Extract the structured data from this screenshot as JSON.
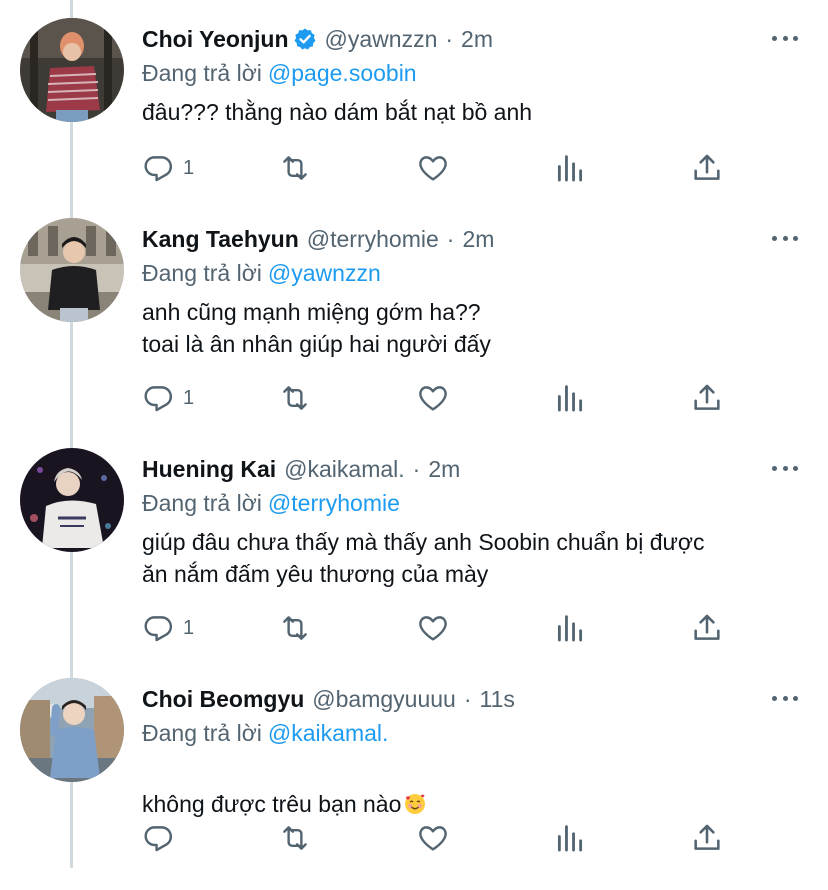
{
  "tweets": [
    {
      "name": "Choi Yeonjun",
      "verified": true,
      "handle": "@yawnzzn",
      "time": "2m",
      "reply_prefix": "Đang trả lời",
      "reply_to": "@page.soobin",
      "text": "đâu??? thằng nào dám bắt nạt bồ anh",
      "reply_count": "1"
    },
    {
      "name": "Kang Taehyun",
      "verified": false,
      "handle": "@terryhomie",
      "time": "2m",
      "reply_prefix": "Đang trả lời",
      "reply_to": "@yawnzzn",
      "text": "anh cũng mạnh miệng gớm ha??\n toai là ân nhân giúp hai người đấy",
      "reply_count": "1"
    },
    {
      "name": "Huening Kai",
      "verified": false,
      "handle": "@kaikamal.",
      "time": "2m",
      "reply_prefix": "Đang trả lời",
      "reply_to": "@terryhomie",
      "text": "giúp đâu chưa thấy mà thấy anh Soobin chuẩn bị được\năn nắm đấm yêu thương của mày",
      "reply_count": "1"
    },
    {
      "name": "Choi Beomgyu",
      "verified": false,
      "handle": "@bamgyuuuu",
      "time": "11s",
      "reply_prefix": "Đang trả lời",
      "reply_to": "@kaikamal.",
      "text": "không được trêu bạn nào",
      "text_emoji": "smiling-face-with-hearts",
      "reply_count": ""
    }
  ],
  "icons": {
    "reply": "comment-icon",
    "retweet": "retweet-icon",
    "like": "heart-icon",
    "analytics": "analytics-icon",
    "share": "share-icon",
    "more": "more-dots-icon"
  },
  "colors": {
    "text": "#0f1419",
    "secondary": "#536471",
    "link": "#1d9bf0",
    "thread_line": "#cfd9de"
  }
}
